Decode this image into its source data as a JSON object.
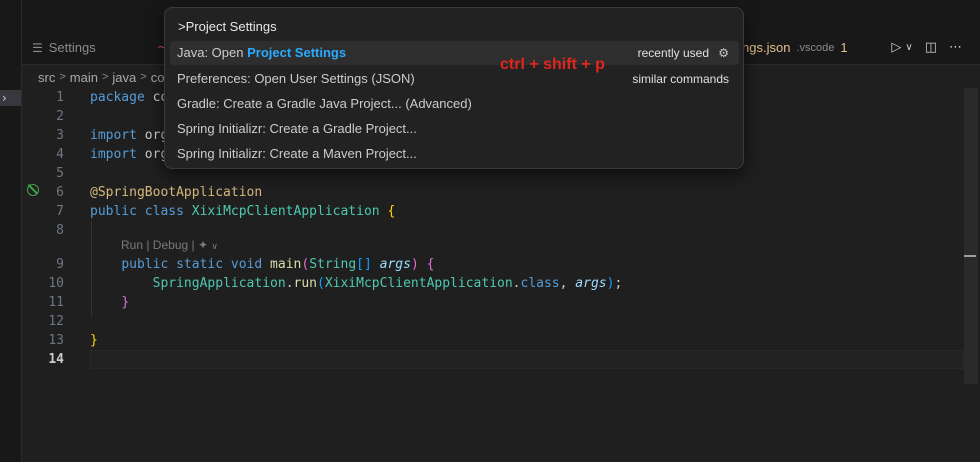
{
  "tabs": {
    "settings_label": "Settings",
    "json_label": "ngs.json",
    "json_dir": ".vscode",
    "json_count": "1"
  },
  "breadcrumb": [
    "src",
    "main",
    "java",
    "co"
  ],
  "palette": {
    "query": ">Project Settings",
    "items": [
      {
        "prefix": "Java: Open ",
        "highlight": "Project Settings",
        "badge": "recently used"
      },
      {
        "label": "Preferences: Open User Settings (JSON)",
        "note": "similar commands"
      },
      {
        "label": "Gradle: Create a Gradle Java Project... (Advanced)"
      },
      {
        "label": "Spring Initializr: Create a Gradle Project..."
      },
      {
        "label": "Spring Initializr: Create a Maven Project..."
      }
    ]
  },
  "shortcut_annotation": "ctrl + shift + p",
  "codelens": "Run | Debug |",
  "code": {
    "l1_kw": "package",
    "l1_rest": " co",
    "l3_kw": "import",
    "l3_rest": " org",
    "l4_kw": "import",
    "l4_rest": " org",
    "l6_ann": "@SpringBootApplication",
    "l7_kw1": "public",
    "l7_kw2": "class",
    "l7_type": "XixiMcpClientApplication",
    "l9_kw1": "public",
    "l9_kw2": "static",
    "l9_kw3": "void",
    "l9_fn": "main",
    "l9_type": "String",
    "l9_param": "args",
    "l10_type1": "SpringApplication",
    "l10_fn": "run",
    "l10_type2": "XixiMcpClientApplication",
    "l10_kw": "class",
    "l10_param": "args"
  },
  "line_numbers": [
    "1",
    "2",
    "3",
    "4",
    "5",
    "6",
    "7",
    "8",
    "9",
    "10",
    "11",
    "12",
    "13",
    "14"
  ],
  "active_line": "14",
  "colors": {
    "highlight": "#2aaaff",
    "annotation": "#e0261d",
    "accent_badge": "#e2c08d"
  }
}
